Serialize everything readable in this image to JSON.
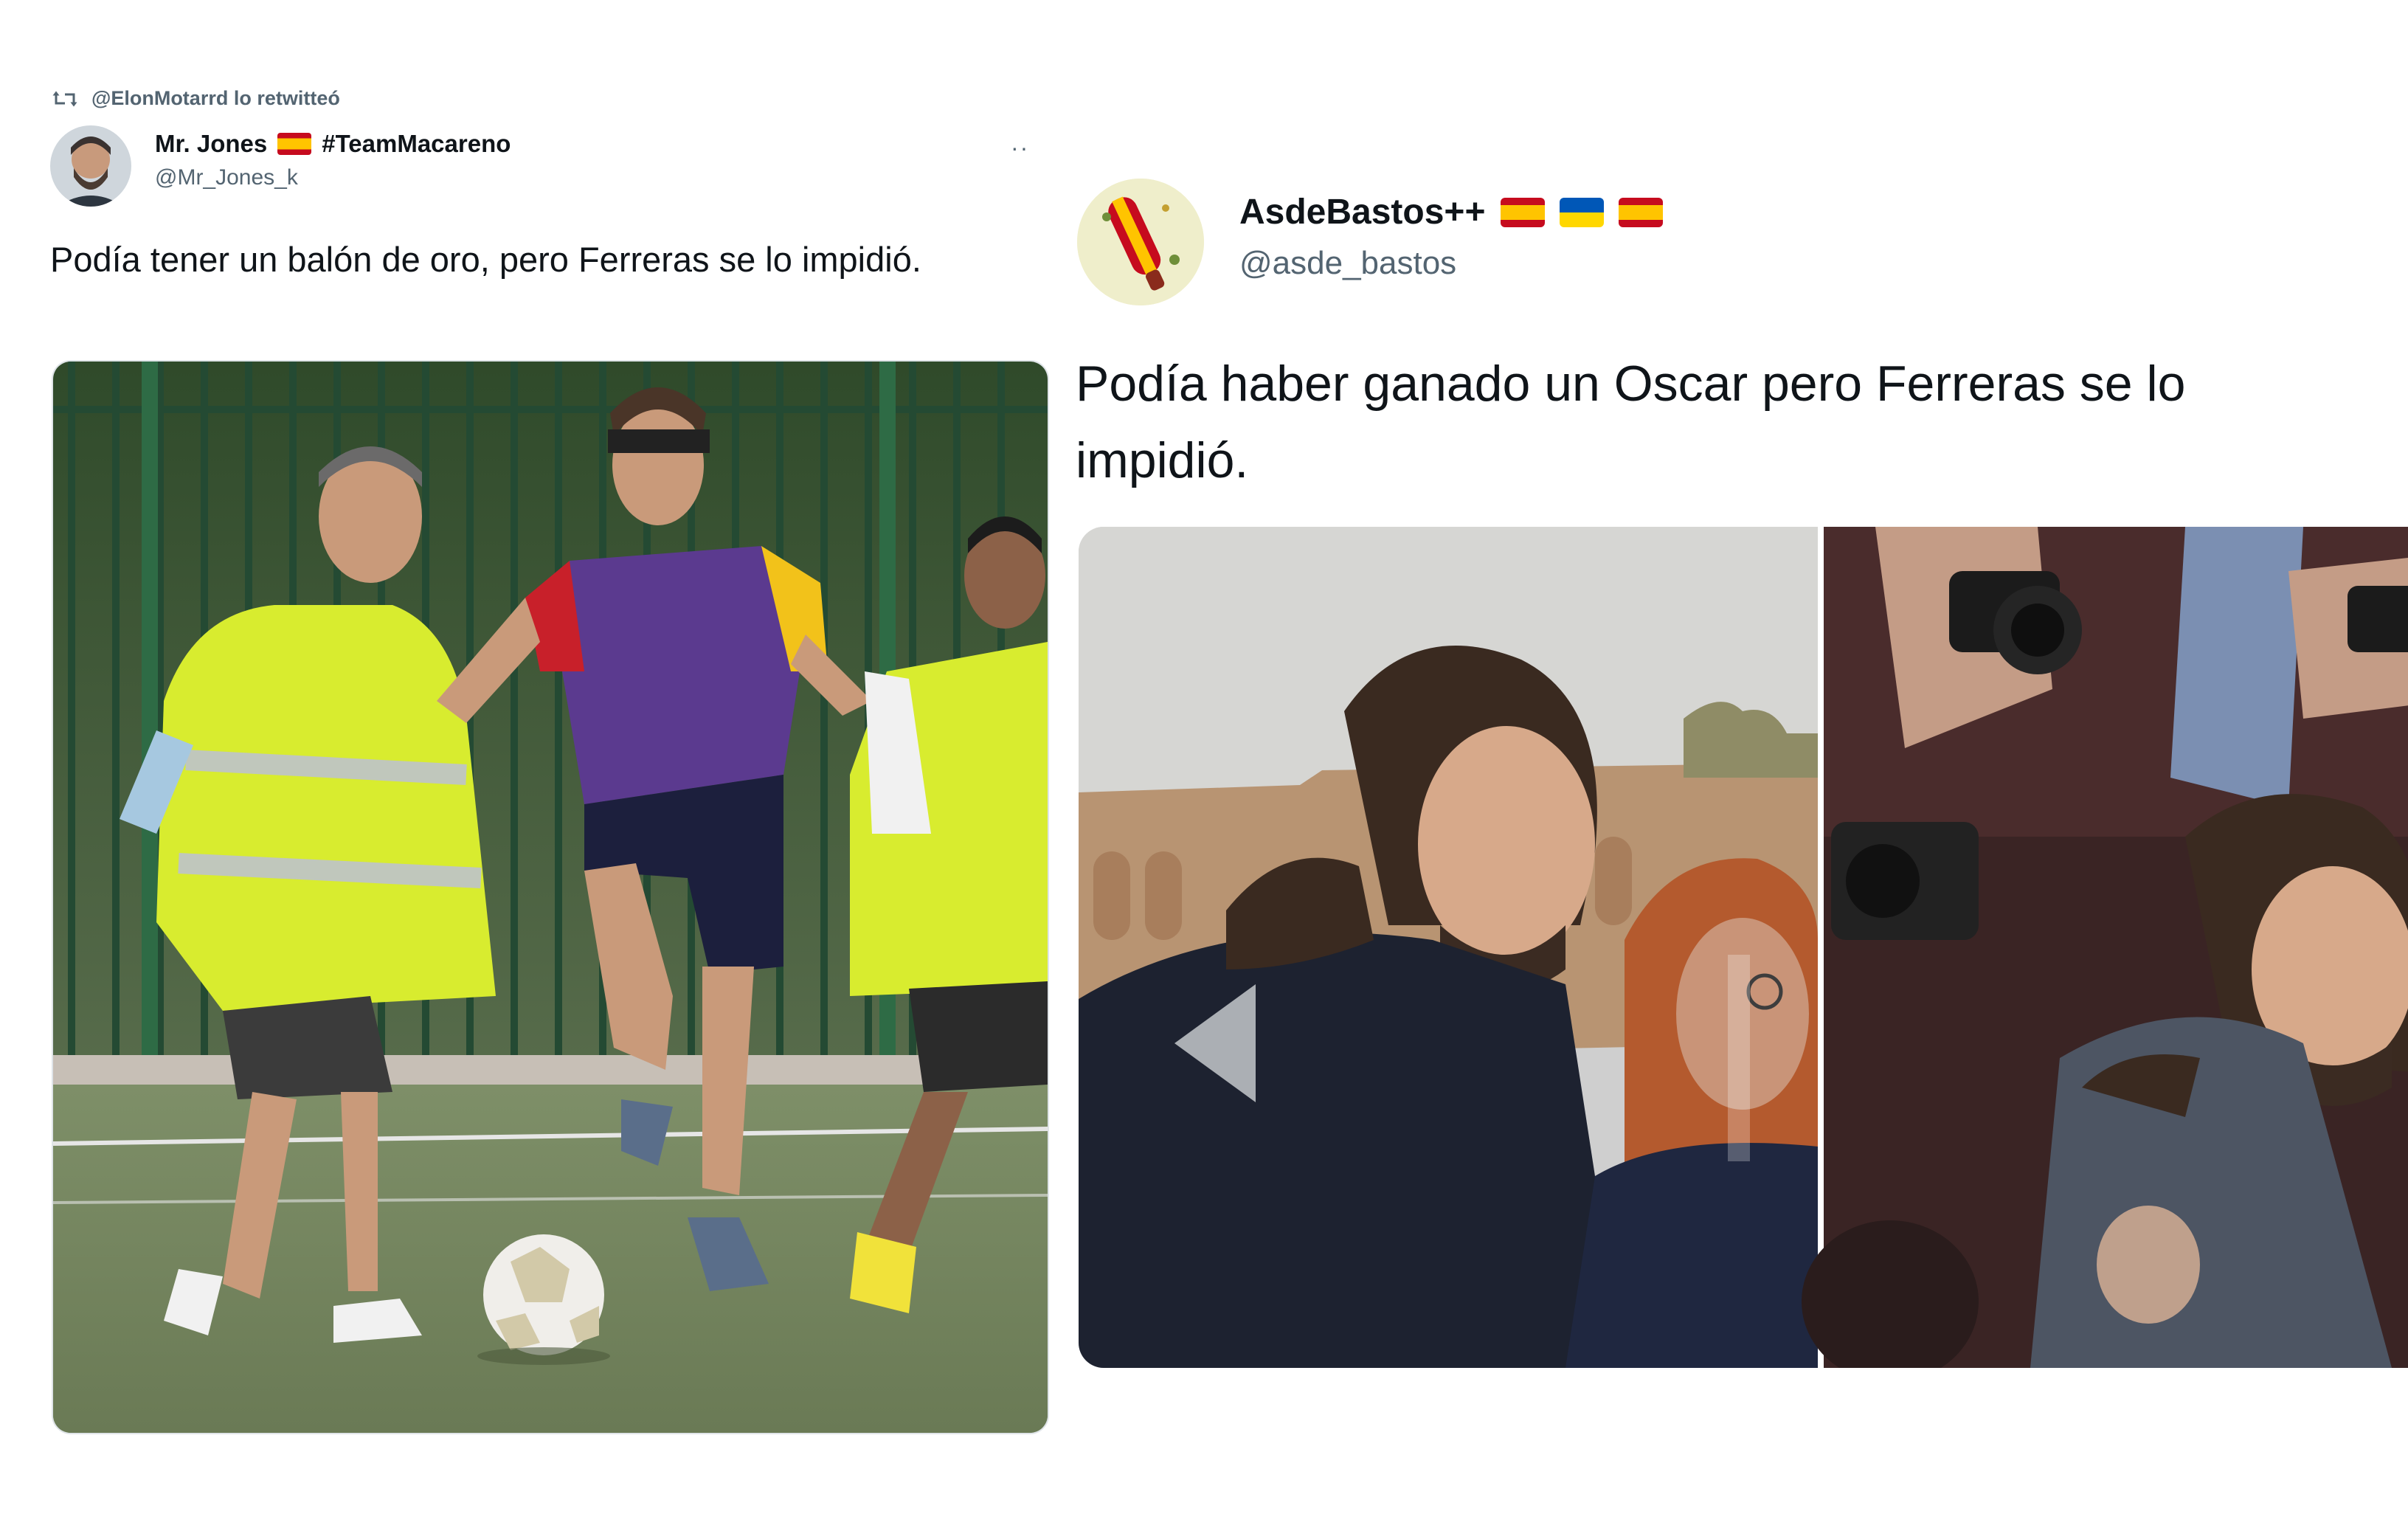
{
  "tweet_1": {
    "retweet_notice": "@ElonMotarrd lo retwitteó",
    "display_name": "Mr. Jones",
    "name_suffix": "#TeamMacareno",
    "handle": "@Mr_Jones_k",
    "more_label": "··",
    "text": "Podía tener un balón de oro, pero Ferreras se lo impidió."
  },
  "tweet_2": {
    "display_name": "AsdeBastos++",
    "handle": "@asde_bastos",
    "text_line_1": "Podía haber ganado un Oscar pero Ferreras se lo",
    "text_line_2": "impidió."
  },
  "icons": {
    "retweet": "retweet-icon",
    "more": "more-icon",
    "flag_spain": "spain-flag-icon",
    "flag_ukraine": "ukraine-flag-icon",
    "gallery_previous": "previous-arrow-icon"
  },
  "colors": {
    "text_primary": "#0f1419",
    "text_secondary": "#536471",
    "spain_red": "#c60b1e",
    "spain_yellow": "#ffc400",
    "ukraine_blue": "#0057b7",
    "ukraine_yellow": "#ffd700"
  }
}
